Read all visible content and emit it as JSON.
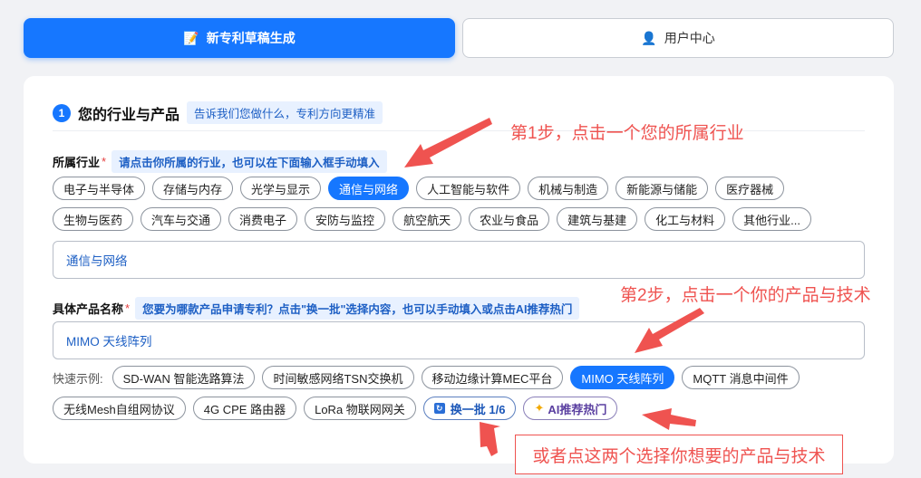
{
  "tabs": {
    "generate_label": "新专利草稿生成",
    "user_center_label": "用户中心"
  },
  "section": {
    "number": "1",
    "title": "您的行业与产品",
    "hint": "告诉我们您做什么，专利方向更精准"
  },
  "industry": {
    "label": "所属行业",
    "required": "*",
    "hint": "请点击你所属的行业，也可以在下面输入框手动填入",
    "row1": [
      "电子与半导体",
      "存储与内存",
      "光学与显示",
      "通信与网络",
      "人工智能与软件",
      "机械与制造",
      "新能源与储能",
      "医疗器械"
    ],
    "row2": [
      "生物与医药",
      "汽车与交通",
      "消费电子",
      "安防与监控",
      "航空航天",
      "农业与食品",
      "建筑与基建",
      "化工与材料",
      "其他行业..."
    ],
    "selected": "通信与网络",
    "input_value": "通信与网络"
  },
  "product": {
    "label": "具体产品名称",
    "required": "*",
    "hint": "您要为哪款产品申请专利？点击\"换一批\"选择内容，也可以手动填入或点击AI推荐热门",
    "input_value": "MIMO 天线阵列",
    "quick_label": "快速示例:",
    "row1": [
      "SD-WAN 智能选路算法",
      "时间敏感网络TSN交换机",
      "移动边缘计算MEC平台",
      "MIMO 天线阵列",
      "MQTT 消息中间件"
    ],
    "row2": [
      "无线Mesh自组网协议",
      "4G CPE 路由器",
      "LoRa 物联网网关"
    ],
    "selected": "MIMO 天线阵列",
    "refresh_label": "换一批 1/6",
    "ai_label": "AI推荐热门"
  },
  "annotations": {
    "step1": "第1步，点击一个您的所属行业",
    "step2": "第2步，点击一个你的产品与技术",
    "alt": "或者点这两个选择你想要的产品与技术"
  },
  "colors": {
    "accent": "#1677ff",
    "annotation": "#ef5350"
  }
}
